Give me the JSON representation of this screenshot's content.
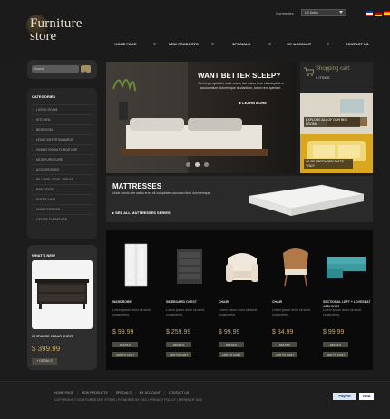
{
  "header": {
    "logo_line1": "Furniture",
    "logo_line2": "store",
    "currencies_label": "Currencies:",
    "currency_value": "US Dollar",
    "nav": [
      "Home page",
      "New products",
      "Specials",
      "My account",
      "Contact us"
    ]
  },
  "sidebar": {
    "search_placeholder": "Search",
    "categories_title": "CATEGORIES",
    "categories": [
      "LIVING ROOM",
      "KITCHEN",
      "BEDROOM",
      "HOME ENTERTAINMENT",
      "DINING ROOM FURNITURE",
      "KIDS FURNITURE",
      "ACCESSORIES",
      "BILLIARD, POOL TABLES",
      "BAR ROOM",
      "ENTRY, HALL",
      "HOME FITNESS",
      "OFFICE FURNITURE"
    ],
    "whats_new_title": "WHAT'S NEW",
    "whats_new_product": "WHITMORE CEDAR CHEST",
    "whats_new_price": "$ 399.99",
    "whats_new_button": "+ DETAILS"
  },
  "slider": {
    "title": "WANT BETTER SLEEP?",
    "description": "Sed ut perspiciatis unde omnis iste natus error sit voluptatem accusantium doloremque laudantium, totam rem aperiam.",
    "more_label": "LEARN MORE"
  },
  "cart": {
    "title": "Shopping cart:",
    "count": "0 ITEMS"
  },
  "promos": [
    {
      "label": "EXPLORE ALL OF OUR BED ROOMS"
    },
    {
      "label": "WHICH SOFA-BED SUITS YOU?"
    }
  ],
  "mattresses": {
    "title": "MATTRESSES",
    "description": "Unde omnis iste natus error sit voluptatem accusan tium dolor emque.",
    "link": "SEE ALL MATTRESSES SERIES"
  },
  "products": [
    {
      "name": "WARDROBE",
      "desc": "Lorem ipsum dolor sit amet, consectetur.",
      "price": "$ 99.99",
      "details": "DETAILS",
      "add": "ADD TO CART"
    },
    {
      "name": "SIDEBOARD CHEST",
      "desc": "Lorem ipsum dolor sit amet, consectetur.",
      "price": "$ 259.99",
      "details": "DETAILS",
      "add": "ADD TO CART"
    },
    {
      "name": "CHAIR",
      "desc": "Lorem ipsum dolor sit amet, consectetur.",
      "price": "$ 99.99",
      "details": "DETAILS",
      "add": "ADD TO CART"
    },
    {
      "name": "CHAIR",
      "desc": "Lorem ipsum dolor sit amet, consectetur.",
      "price": "$ 34.99",
      "details": "DETAILS",
      "add": "ADD TO CART"
    },
    {
      "name": "SECTIONAL LEFT + LOVESEAT ARM SOFA",
      "desc": "Lorem ipsum dolor sit amet, consectetur.",
      "price": "$ 99.99",
      "details": "DETAILS",
      "add": "ADD TO CART"
    }
  ],
  "footer": {
    "links": [
      "HOME PAGE",
      "NEW PRODUCTS",
      "SPECIALS",
      "MY ACCOUNT",
      "CONTACT US"
    ],
    "copyright": "COPYRIGHT © 2013 FURNITURE STORE | POWERED BY OSC | PRIVACY POLICY | TERMS OF USE",
    "paypal": "PayPal",
    "visa": "VISA"
  },
  "colors": {
    "accent": "#c8a860",
    "background": "#1c1c1c"
  }
}
